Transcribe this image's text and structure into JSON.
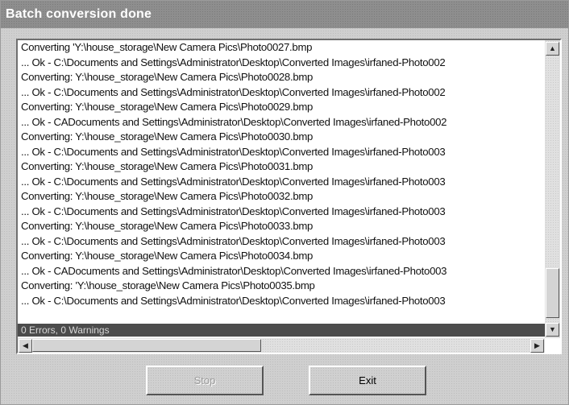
{
  "window": {
    "title": "Batch conversion done"
  },
  "log": {
    "lines": [
      "Converting 'Y:\\house_storage\\New Camera Pics\\Photo0027.bmp",
      "... Ok - C:\\Documents and Settings\\Administrator\\Desktop\\Converted Images\\irfaned-Photo002",
      "Converting: Y:\\house_storage\\New Camera Pics\\Photo0028.bmp",
      "... Ok - C:\\Documents and Settings\\Administrator\\Desktop\\Converted Images\\irfaned-Photo002",
      "Converting: Y:\\house_storage\\New Camera Pics\\Photo0029.bmp",
      "... Ok - CADocuments and Settings\\Administrator\\Desktop\\Converted Images\\irfaned-Photo002",
      "Converting: Y:\\house_storage\\New Camera Pics\\Photo0030.bmp",
      "... Ok - C:\\Documents and Settings\\Administrator\\Desktop\\Converted Images\\irfaned-Photo003",
      "Converting: Y:\\house_storage\\New Camera Pics\\Photo0031.bmp",
      "... Ok - C:\\Documents and Settings\\Administrator\\Desktop\\Converted Images\\irfaned-Photo003",
      "Converting: Y:\\house_storage\\New Camera Pics\\Photo0032.bmp",
      "... Ok - C:\\Documents and Settings\\Administrator\\Desktop\\Converted Images\\irfaned-Photo003",
      "Converting: Y:\\house_storage\\New Camera Pics\\Photo0033.bmp",
      "... Ok - C:\\Documents and Settings\\Administrator\\Desktop\\Converted Images\\irfaned-Photo003",
      "Converting: Y:\\house_storage\\New Camera Pics\\Photo0034.bmp",
      "... Ok - CADocuments and Settings\\Administrator\\Desktop\\Converted Images\\irfaned-Photo003",
      "Converting: 'Y:\\house_storage\\New Camera Pics\\Photo0035.bmp",
      "... Ok - C:\\Documents and Settings\\Administrator\\Desktop\\Converted Images\\irfaned-Photo003"
    ],
    "summary": "0 Errors, 0 Warnings"
  },
  "scroll": {
    "up_icon": "arrow-up-icon",
    "down_icon": "arrow-down-icon",
    "left_icon": "arrow-left-icon",
    "right_icon": "arrow-right-icon"
  },
  "buttons": {
    "stop_label": "Stop",
    "exit_label": "Exit",
    "stop_enabled": false
  },
  "colors": {
    "titlebar": "#8e8e8e",
    "summary_bar": "#4c4c4c",
    "log_background": "#ffffff"
  }
}
